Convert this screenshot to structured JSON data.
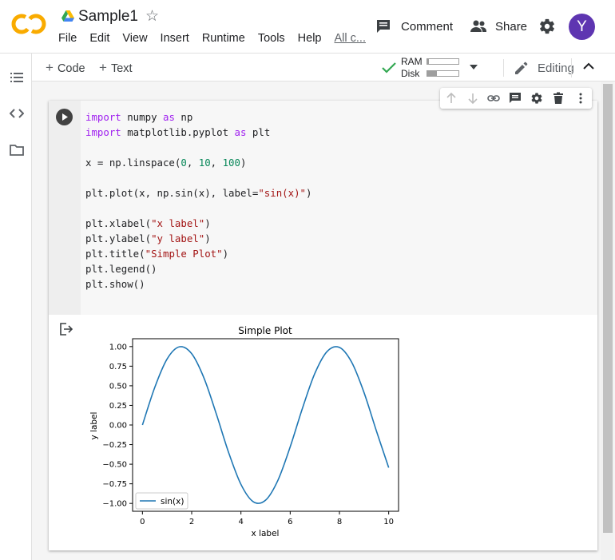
{
  "app": {
    "title": "Sample1",
    "menu": [
      "File",
      "Edit",
      "View",
      "Insert",
      "Runtime",
      "Tools",
      "Help",
      "All c..."
    ],
    "comment_label": "Comment",
    "share_label": "Share",
    "avatar_initial": "Y",
    "logo_text": "CO",
    "colors": {
      "avatar": "#5e35b1",
      "logo_orange": "#f9ab00",
      "check_green": "#34a853"
    }
  },
  "toolbar": {
    "code_label": "Code",
    "text_label": "Text",
    "ram_label": "RAM",
    "disk_label": "Disk",
    "ram_usage": 0.04,
    "disk_usage": 0.3,
    "editing_label": "Editing"
  },
  "cell": {
    "code_lines": [
      "import numpy as np",
      "import matplotlib.pyplot as plt",
      "",
      "x = np.linspace(0, 10, 100)",
      "",
      "plt.plot(x, np.sin(x), label=\"sin(x)\")",
      "",
      "plt.xlabel(\"x label\")",
      "plt.ylabel(\"y label\")",
      "plt.title(\"Simple Plot\")",
      "plt.legend()",
      "plt.show()"
    ]
  },
  "chart_data": {
    "type": "line",
    "title": "Simple Plot",
    "xlabel": "x label",
    "ylabel": "y label",
    "xlim": [
      0,
      10
    ],
    "ylim": [
      -1.0,
      1.0
    ],
    "xticks": [
      "0",
      "2",
      "4",
      "6",
      "8",
      "10"
    ],
    "yticks": [
      "1.00",
      "0.75",
      "0.50",
      "0.25",
      "0.00",
      "−0.25",
      "−0.50",
      "−0.75",
      "−1.00"
    ],
    "legend": "lower-left",
    "series": [
      {
        "name": "sin(x)",
        "color": "#1f77b4",
        "x": [
          0,
          0.5,
          1,
          1.5,
          2,
          2.5,
          3,
          3.5,
          4,
          4.5,
          5,
          5.5,
          6,
          6.5,
          7,
          7.5,
          8,
          8.5,
          9,
          9.5,
          10
        ],
        "y": [
          0,
          0.479,
          0.841,
          0.997,
          0.909,
          0.598,
          0.141,
          -0.351,
          -0.757,
          -0.978,
          -0.959,
          -0.706,
          -0.279,
          0.215,
          0.657,
          0.938,
          0.989,
          0.798,
          0.412,
          -0.075,
          -0.544
        ]
      }
    ]
  }
}
